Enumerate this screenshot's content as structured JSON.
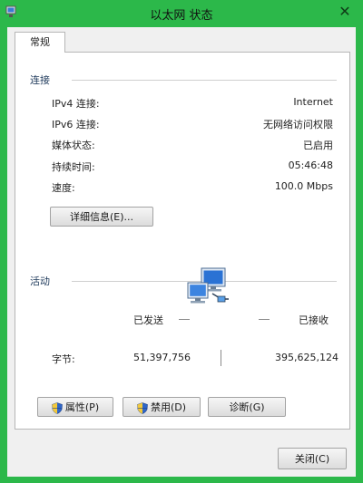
{
  "window": {
    "title": "以太网 状态",
    "close_glyph": "✕"
  },
  "tabs": [
    {
      "label": "常规"
    }
  ],
  "connection": {
    "group_label": "连接",
    "rows": [
      {
        "label": "IPv4 连接:",
        "value": "Internet"
      },
      {
        "label": "IPv6 连接:",
        "value": "无网络访问权限"
      },
      {
        "label": "媒体状态:",
        "value": "已启用"
      },
      {
        "label": "持续时间:",
        "value": "05:46:48"
      },
      {
        "label": "速度:",
        "value": "100.0 Mbps"
      }
    ],
    "details_button": "详细信息(E)..."
  },
  "activity": {
    "group_label": "活动",
    "sent_label": "已发送",
    "received_label": "已接收",
    "bytes_label": "字节:",
    "bytes_sent": "51,397,756",
    "bytes_received": "395,625,124"
  },
  "buttons": {
    "properties": "属性(P)",
    "disable": "禁用(D)",
    "diagnose": "诊断(G)",
    "close": "关闭(C)"
  },
  "icons": {
    "app": "network-adapter-icon",
    "shield": "uac-shield-icon",
    "network": "network-computers-icon"
  },
  "colors": {
    "frame": "#2cb84a",
    "group_label": "#1e395b"
  }
}
